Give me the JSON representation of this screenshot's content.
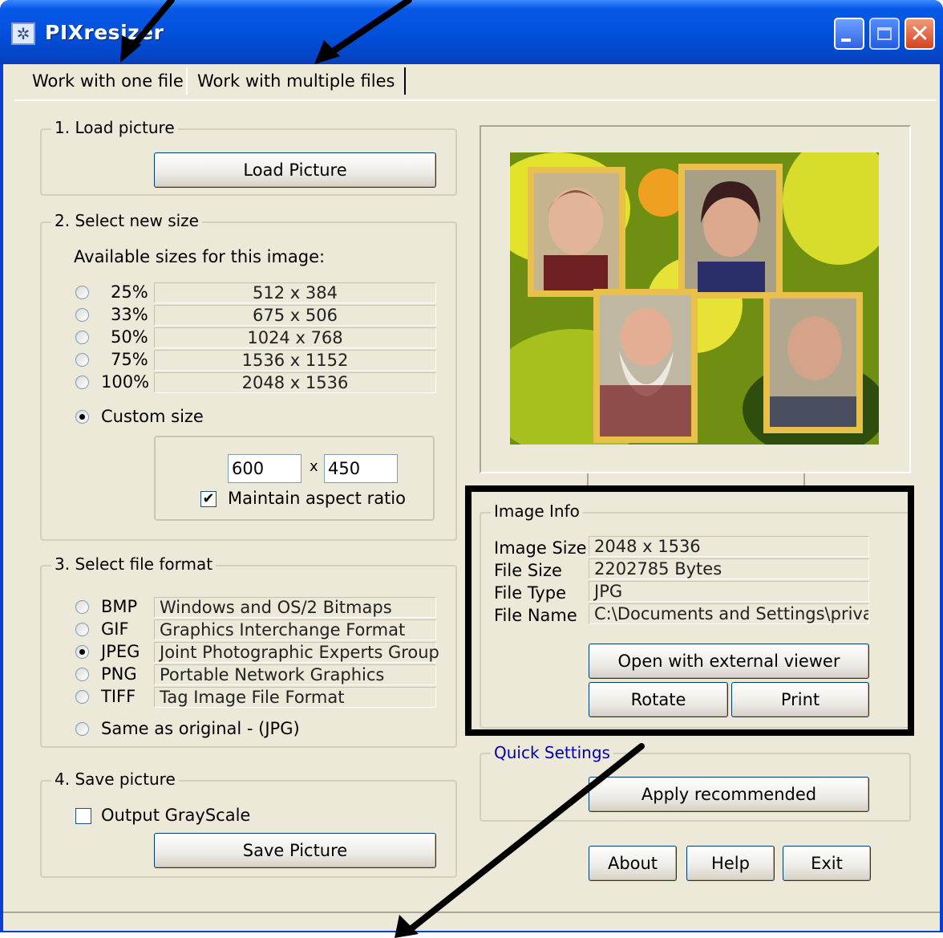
{
  "window": {
    "title": "PIXresizer",
    "colors": {
      "titlebar": "#0250dd",
      "client": "#ece9d8",
      "accent_blue": "#0000a8"
    },
    "icons": {
      "app": "app-logo-icon",
      "minimize": "minimize-icon",
      "maximize": "maximize-icon",
      "close": "close-icon"
    }
  },
  "tabs": [
    {
      "label": "Work with one file",
      "selected": true
    },
    {
      "label": "Work with multiple files",
      "selected": false
    }
  ],
  "load": {
    "legend": "1. Load picture",
    "button": "Load Picture"
  },
  "size": {
    "legend": "2. Select new size",
    "available_label": "Available sizes for this image:",
    "options": [
      {
        "pct": "25%",
        "dims": "512 x 384"
      },
      {
        "pct": "33%",
        "dims": "675 x 506"
      },
      {
        "pct": "50%",
        "dims": "1024 x 768"
      },
      {
        "pct": "75%",
        "dims": "1536 x 1152"
      },
      {
        "pct": "100%",
        "dims": "2048 x 1536"
      }
    ],
    "custom_label": "Custom size",
    "custom_selected": true,
    "width_value": "600",
    "times": "x",
    "height_value": "450",
    "aspect_label": "Maintain aspect ratio",
    "aspect_checked": true
  },
  "format": {
    "legend": "3. Select file format",
    "options": [
      {
        "code": "BMP",
        "desc": "Windows and OS/2 Bitmaps",
        "selected": false
      },
      {
        "code": "GIF",
        "desc": "Graphics Interchange Format",
        "selected": false
      },
      {
        "code": "JPEG",
        "desc": "Joint Photographic Experts Group",
        "selected": true
      },
      {
        "code": "PNG",
        "desc": "Portable Network Graphics",
        "selected": false
      },
      {
        "code": "TIFF",
        "desc": "Tag Image File Format",
        "selected": false
      }
    ],
    "same_label": "Same as original  - (JPG)"
  },
  "save": {
    "legend": "4. Save picture",
    "grayscale_label": "Output GrayScale",
    "grayscale_checked": false,
    "button": "Save Picture"
  },
  "info": {
    "legend": "Image Info",
    "rows": [
      {
        "label": "Image Size",
        "value": "2048 x 1536"
      },
      {
        "label": "File Size",
        "value": "2202785 Bytes"
      },
      {
        "label": "File Type",
        "value": "JPG"
      },
      {
        "label": "File Name",
        "value": "C:\\Documents and Settings\\private\\"
      }
    ],
    "open_button": "Open with external viewer",
    "rotate_button": "Rotate",
    "print_button": "Print"
  },
  "quick": {
    "legend": "Quick Settings",
    "apply_button": "Apply recommended"
  },
  "footer": {
    "about": "About",
    "help": "Help",
    "exit": "Exit"
  }
}
